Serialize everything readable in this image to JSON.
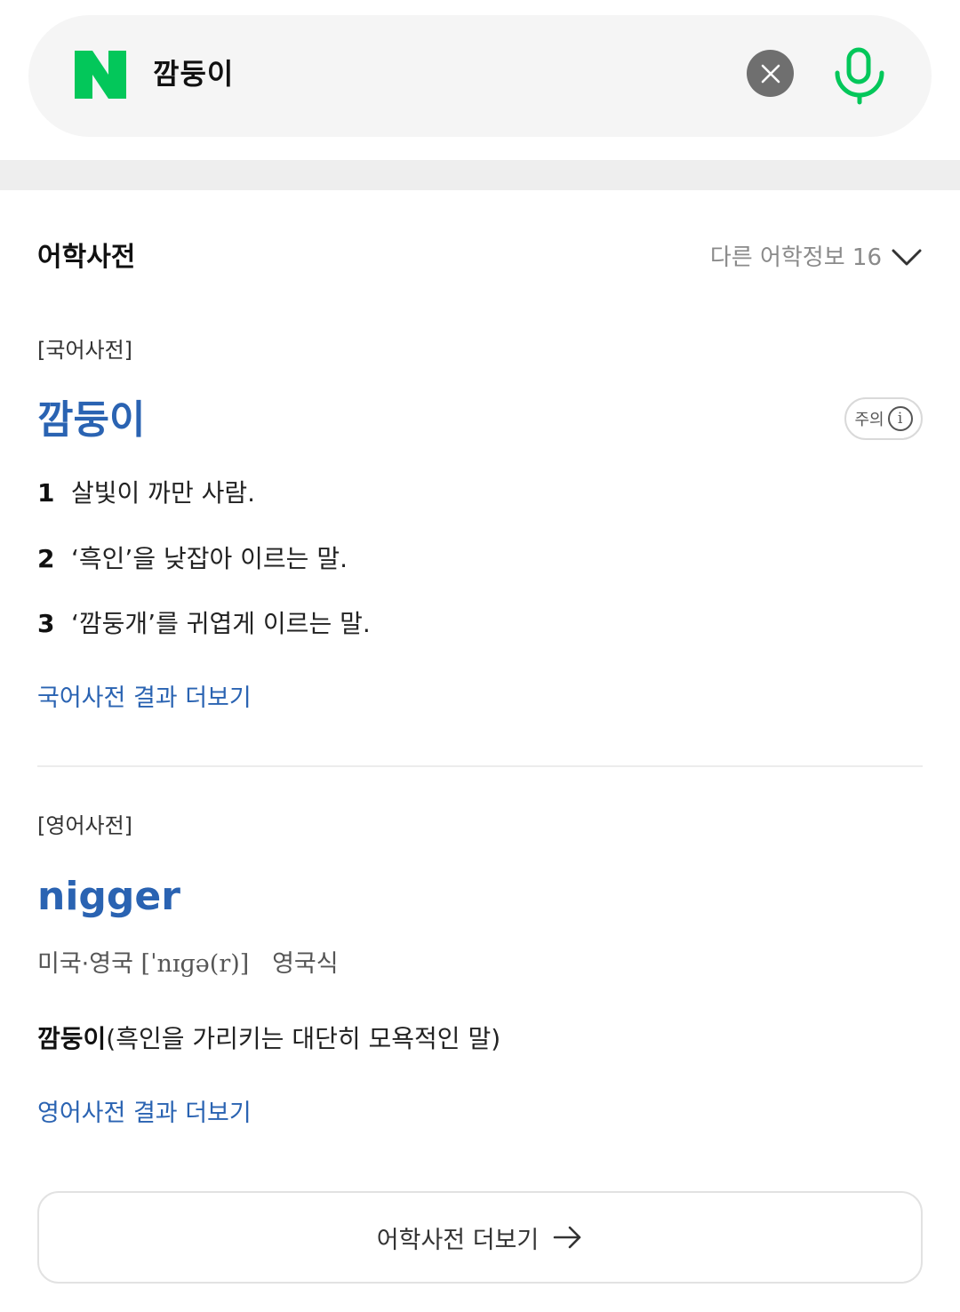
{
  "search": {
    "query": "깜둥이",
    "logo_letter": "N",
    "colors": {
      "brand_green": "#03c75a",
      "clear_bg": "#6f6f6f"
    }
  },
  "icons": {
    "logo": "naver-logo",
    "clear": "close-icon",
    "mic": "mic-icon",
    "dropdown": "chevron-down-icon",
    "info": "info-icon",
    "arrow": "arrow-right-icon"
  },
  "dictionary": {
    "title": "어학사전",
    "other_info": "다른 어학정보 16",
    "korean": {
      "label": "[국어사전]",
      "headword": "깜둥이",
      "caution": "주의",
      "definitions": [
        {
          "num": "1",
          "text": "살빛이 까만 사람."
        },
        {
          "num": "2",
          "text": "‘흑인’을 낮잡아 이르는 말."
        },
        {
          "num": "3",
          "text": "‘깜둥개’를 귀엽게 이르는 말."
        }
      ],
      "more": "국어사전 결과 더보기"
    },
    "english": {
      "label": "[영어사전]",
      "headword": "nigger",
      "region": "미국·영국",
      "ipa": "[ˈnɪɡə(r)]",
      "accent": "영국식",
      "meaning_bold": "깜둥이",
      "meaning_rest": "(흑인을 가리키는 대단히 모욕적인 말)",
      "more": "영어사전 결과 더보기"
    },
    "more_button": "어학사전 더보기"
  },
  "colors": {
    "link_blue": "#2a63b2",
    "muted_gray": "#8a8a8a"
  }
}
